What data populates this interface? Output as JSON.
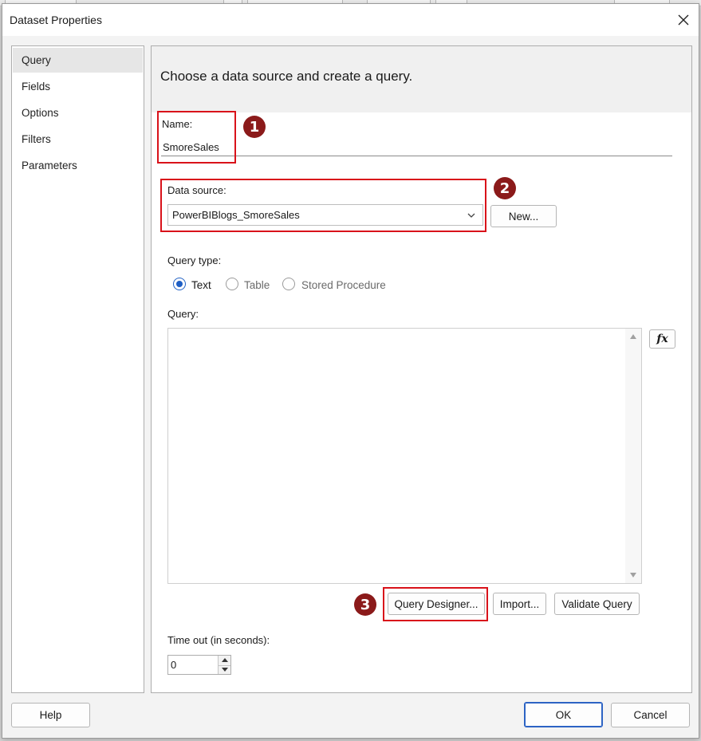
{
  "dialog": {
    "title": "Dataset Properties",
    "header_text": "Choose a data source and create a query."
  },
  "nav": {
    "items": [
      {
        "label": "Query",
        "selected": true
      },
      {
        "label": "Fields",
        "selected": false
      },
      {
        "label": "Options",
        "selected": false
      },
      {
        "label": "Filters",
        "selected": false
      },
      {
        "label": "Parameters",
        "selected": false
      }
    ]
  },
  "form": {
    "name_label": "Name:",
    "name_value": "SmoreSales",
    "datasource_label": "Data source:",
    "datasource_value": "PowerBIBlogs_SmoreSales",
    "new_button": "New...",
    "query_type_label": "Query type:",
    "query_types": [
      {
        "label": "Text",
        "checked": true
      },
      {
        "label": "Table",
        "checked": false
      },
      {
        "label": "Stored Procedure",
        "checked": false
      }
    ],
    "query_label": "Query:",
    "query_value": "",
    "fx_label": "fx",
    "query_designer_button": "Query Designer...",
    "import_button": "Import...",
    "validate_button": "Validate Query",
    "timeout_label": "Time out (in seconds):",
    "timeout_value": "0"
  },
  "annotations": {
    "badges": [
      "1",
      "2",
      "3"
    ]
  },
  "footer": {
    "help_button": "Help",
    "ok_button": "OK",
    "cancel_button": "Cancel"
  },
  "icons": {
    "close": "close-icon",
    "chevron": "chevron-down-icon",
    "scroll_up": "scroll-up-icon",
    "scroll_down": "scroll-down-icon",
    "spin_up": "spin-up-icon",
    "spin_down": "spin-down-icon"
  },
  "colors": {
    "annotation_red": "#d9121a",
    "badge_maroon": "#8b1a1a",
    "accent_blue": "#1f5fc4",
    "selected_nav": "#e6e6e6"
  }
}
